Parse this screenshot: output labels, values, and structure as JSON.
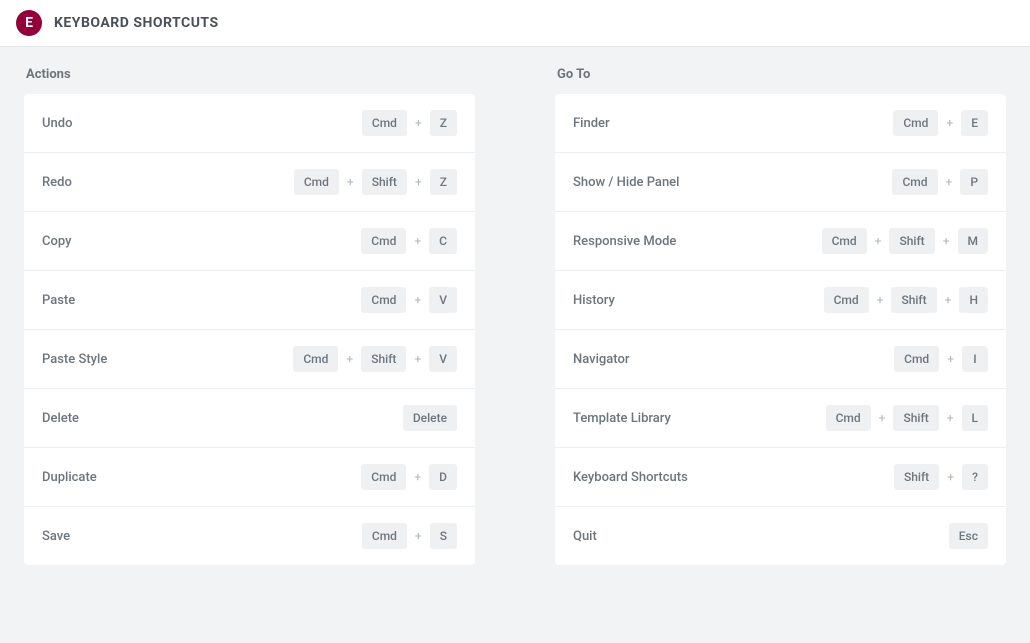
{
  "header": {
    "logo_letter": "E",
    "title": "KEYBOARD SHORTCUTS"
  },
  "plus": "+",
  "sections": {
    "actions": {
      "title": "Actions",
      "rows": [
        {
          "label": "Undo",
          "keys": [
            "Cmd",
            "Z"
          ]
        },
        {
          "label": "Redo",
          "keys": [
            "Cmd",
            "Shift",
            "Z"
          ]
        },
        {
          "label": "Copy",
          "keys": [
            "Cmd",
            "C"
          ]
        },
        {
          "label": "Paste",
          "keys": [
            "Cmd",
            "V"
          ]
        },
        {
          "label": "Paste Style",
          "keys": [
            "Cmd",
            "Shift",
            "V"
          ]
        },
        {
          "label": "Delete",
          "keys": [
            "Delete"
          ]
        },
        {
          "label": "Duplicate",
          "keys": [
            "Cmd",
            "D"
          ]
        },
        {
          "label": "Save",
          "keys": [
            "Cmd",
            "S"
          ]
        }
      ]
    },
    "goto": {
      "title": "Go To",
      "rows": [
        {
          "label": "Finder",
          "keys": [
            "Cmd",
            "E"
          ]
        },
        {
          "label": "Show / Hide Panel",
          "keys": [
            "Cmd",
            "P"
          ]
        },
        {
          "label": "Responsive Mode",
          "keys": [
            "Cmd",
            "Shift",
            "M"
          ]
        },
        {
          "label": "History",
          "keys": [
            "Cmd",
            "Shift",
            "H"
          ]
        },
        {
          "label": "Navigator",
          "keys": [
            "Cmd",
            "I"
          ]
        },
        {
          "label": "Template Library",
          "keys": [
            "Cmd",
            "Shift",
            "L"
          ]
        },
        {
          "label": "Keyboard Shortcuts",
          "keys": [
            "Shift",
            "?"
          ]
        },
        {
          "label": "Quit",
          "keys": [
            "Esc"
          ]
        }
      ]
    }
  }
}
